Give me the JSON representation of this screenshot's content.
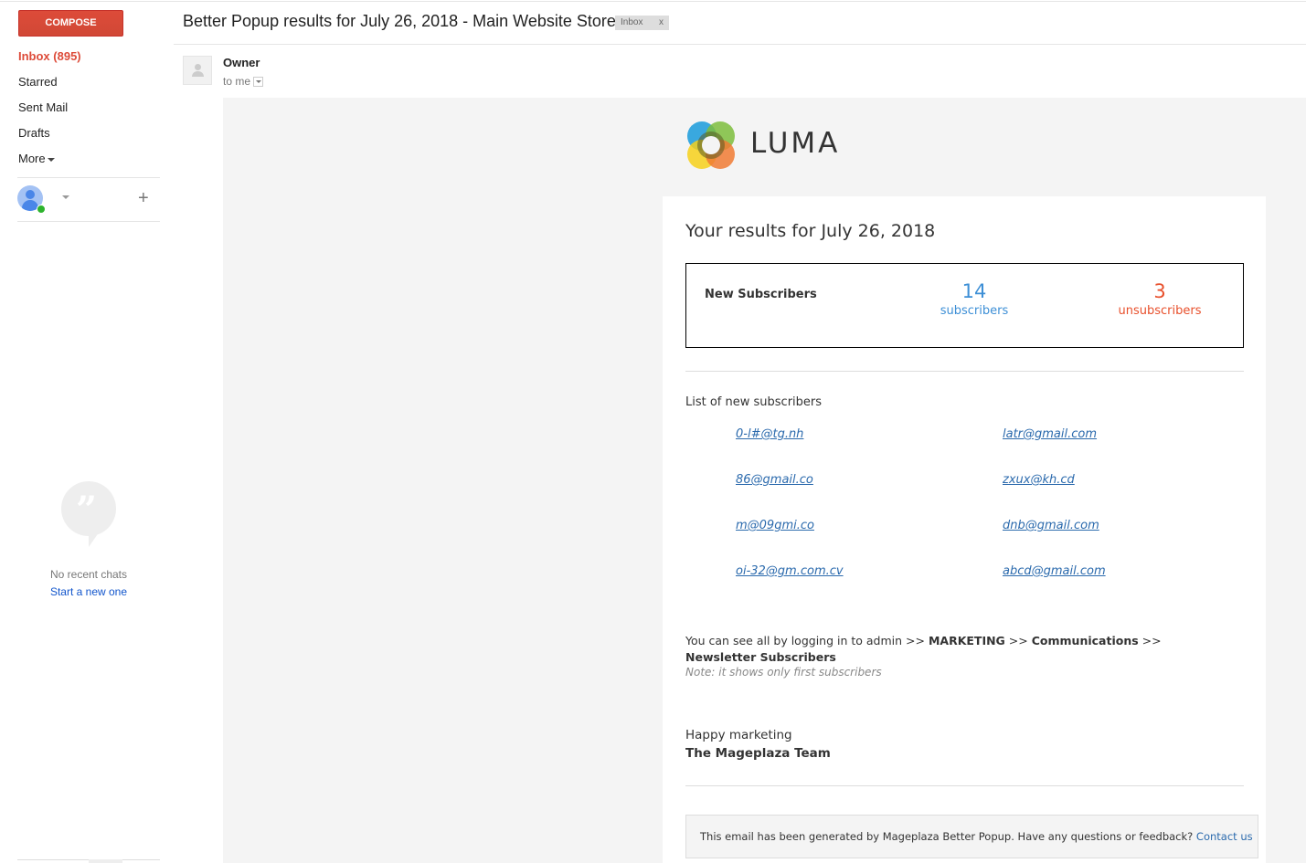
{
  "sidebar": {
    "compose_label": "COMPOSE",
    "nav_items": [
      {
        "label": "Inbox (895)",
        "active": true
      },
      {
        "label": "Starred"
      },
      {
        "label": "Sent Mail"
      },
      {
        "label": "Drafts"
      },
      {
        "label": "More"
      }
    ],
    "chat": {
      "empty_text": "No recent chats",
      "start_link": "Start a new one"
    }
  },
  "header": {
    "subject": "Better Popup results for July 26, 2018 - Main Website Store",
    "label_chip": "Inbox",
    "label_remove": "x",
    "sender": "Owner",
    "recipient": "to me"
  },
  "email": {
    "brand": "LUMA",
    "results_title": "Your results for July 26, 2018",
    "stats": {
      "label": "New Subscribers",
      "subscribers_count": "14",
      "subscribers_label": "subscribers",
      "unsubscribers_count": "3",
      "unsubscribers_label": "unsubscribers",
      "subscribers_color": "#3d8fd6",
      "unsubscribers_color": "#e8502c"
    },
    "list_title": "List of new subscribers",
    "subscribers": [
      "0-l#@tg.nh",
      "latr@gmail.com",
      "86@gmail.co",
      "zxux@kh.cd",
      "m@09gmi.co",
      "dnb@gmail.com",
      "oi-32@gm.com.cv",
      "abcd@gmail.com"
    ],
    "info": {
      "prefix": "You can see all by logging in to admin >> ",
      "step1": "MARKETING",
      "sep1": " >> ",
      "step2": "Communications",
      "sep2": " >> ",
      "step3": "Newsletter Subscribers"
    },
    "note": "Note: it shows only first subscribers",
    "signoff": "Happy marketing",
    "team": "The Mageplaza Team",
    "footer_text": "This email has been generated by Mageplaza Better Popup. Have any questions or feedback? ",
    "footer_link": "Contact us"
  }
}
